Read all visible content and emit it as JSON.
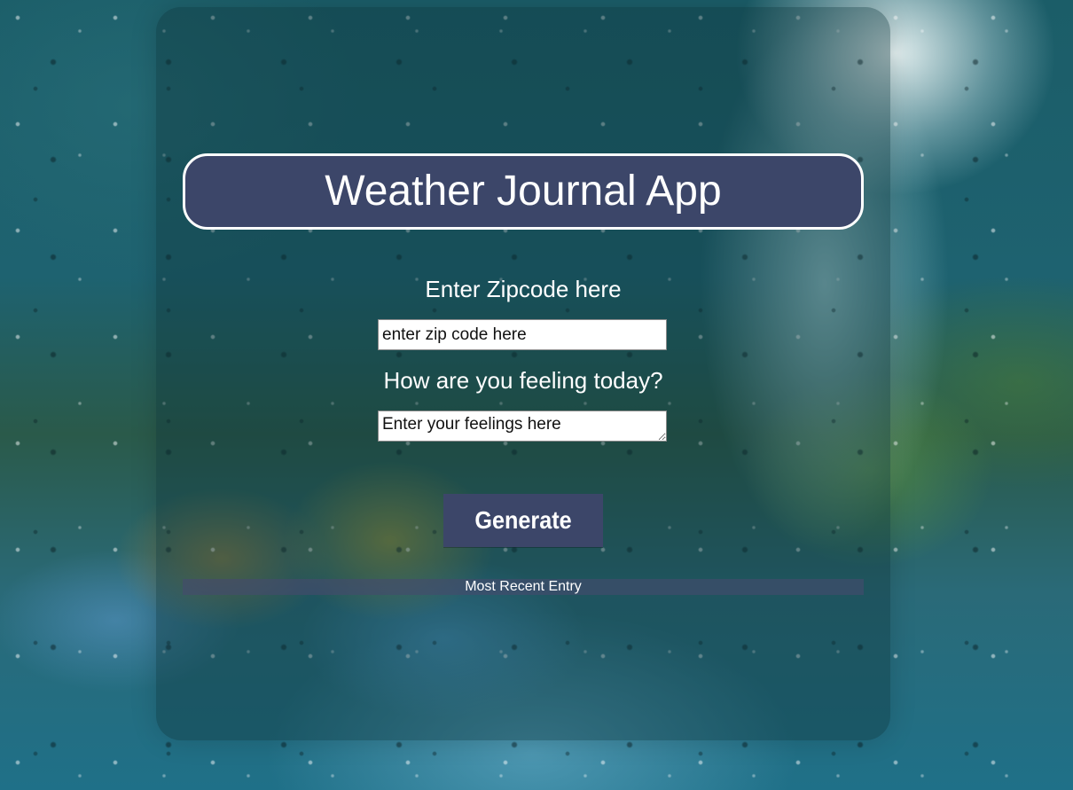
{
  "app": {
    "title": "Weather Journal App"
  },
  "zip": {
    "label": "Enter Zipcode here",
    "placeholder": "enter zip code here",
    "value": ""
  },
  "feelings": {
    "label": "How are you feeling today?",
    "placeholder": "Enter your feelings here",
    "value": ""
  },
  "actions": {
    "generate_label": "Generate"
  },
  "recent": {
    "title": "Most Recent Entry"
  },
  "colors": {
    "accent": "#3c4669",
    "text": "#ffffff",
    "input_bg": "#ffffff"
  }
}
